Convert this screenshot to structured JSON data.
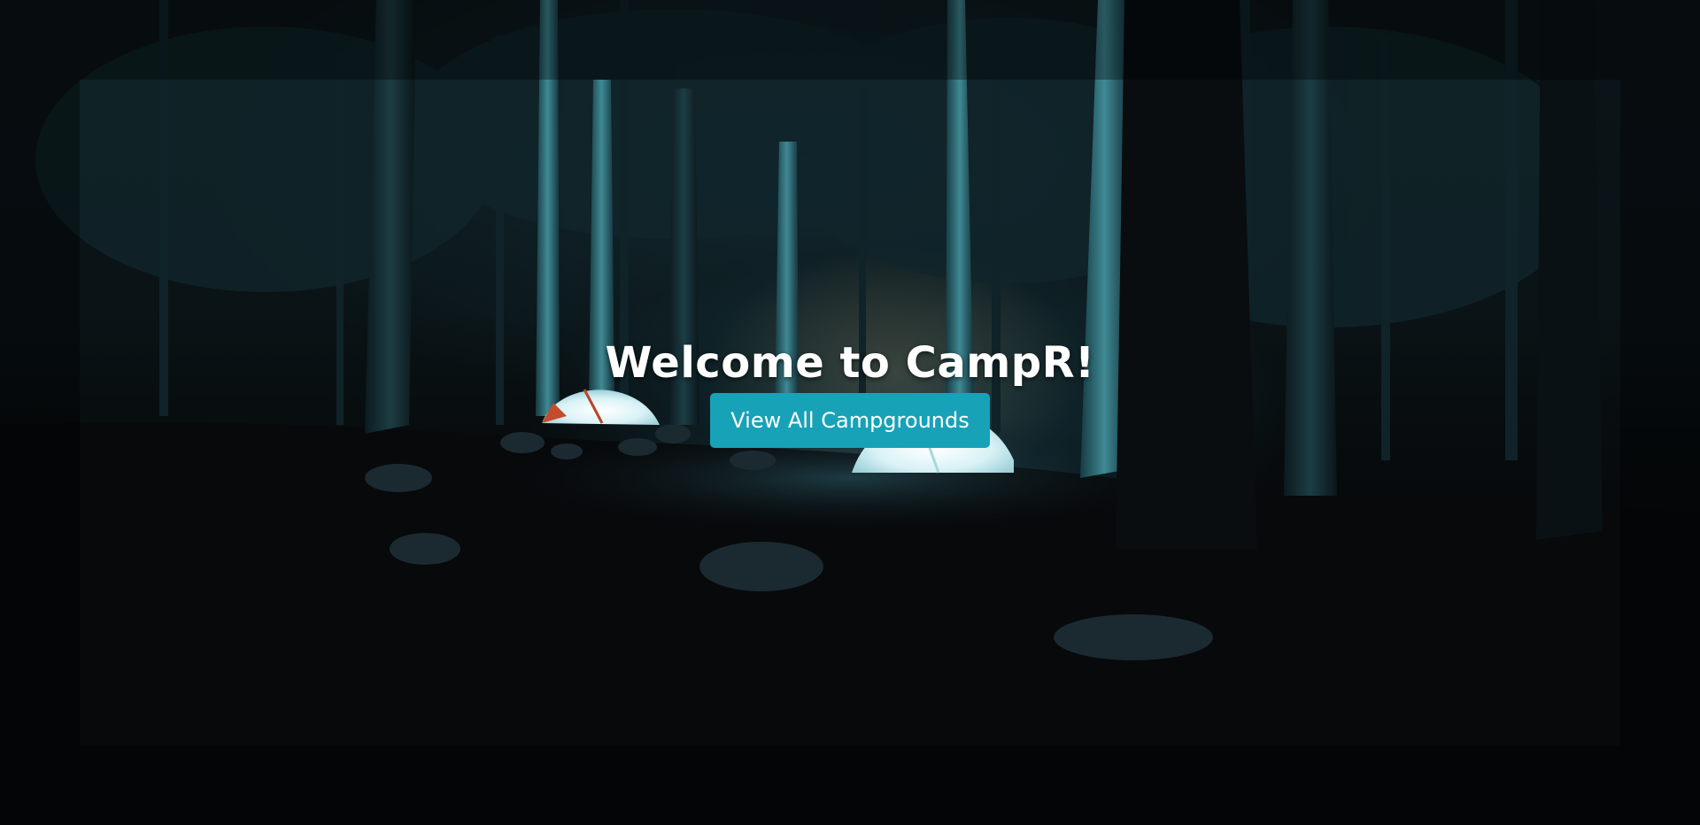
{
  "hero": {
    "title": "Welcome to CampR!",
    "button_label": "View All Campgrounds"
  },
  "colors": {
    "button_bg": "#17a2b8",
    "title_text": "#ffffff",
    "background": "#050709"
  }
}
